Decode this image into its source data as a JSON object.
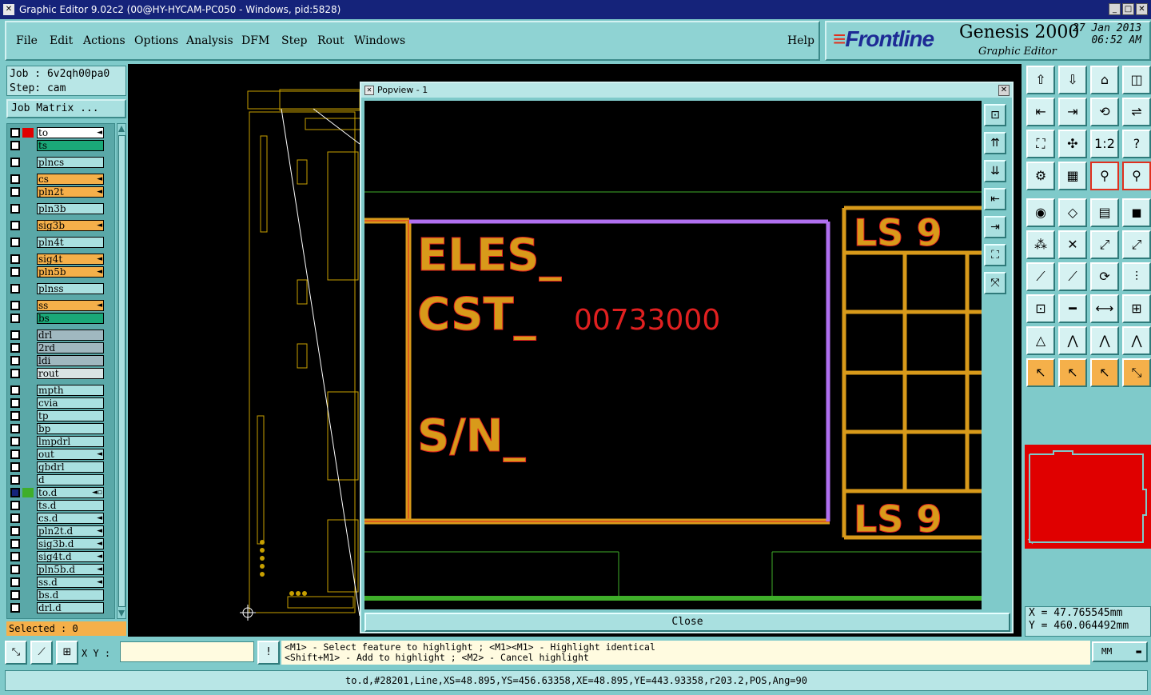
{
  "window": {
    "title": "Graphic Editor 9.02c2 (00@HY-HYCAM-PC050 - Windows, pid:5828)",
    "min": "_",
    "max": "□",
    "close": "✕"
  },
  "menu": [
    "File",
    "Edit",
    "Actions",
    "Options",
    "Analysis",
    "DFM",
    "Step",
    "Rout",
    "Windows"
  ],
  "help": "Help",
  "brand": {
    "logo_stripes": "≡",
    "logo": "Frontline",
    "product": "Genesis 2000",
    "subtitle": "Graphic Editor",
    "date": "27 Jan 2013",
    "time": "06:52 AM"
  },
  "job": {
    "job_line": "Job : 6v2qh00pa0",
    "step_line": "Step: cam",
    "job_matrix": "Job Matrix ..."
  },
  "layers": [
    {
      "name": "to",
      "bg": "#ffffff",
      "color": "#e00000",
      "arrow": "◄"
    },
    {
      "name": "ts",
      "bg": "#1aa878",
      "color": "",
      "arrow": ""
    },
    {
      "name": "plncs",
      "bg": "#a9e0e0",
      "color": "",
      "arrow": ""
    },
    {
      "name": "cs",
      "bg": "#f5b04a",
      "color": "",
      "arrow": "◄"
    },
    {
      "name": "pln2t",
      "bg": "#f5b04a",
      "color": "",
      "arrow": "◄"
    },
    {
      "name": "pln3b",
      "bg": "#a9e0e0",
      "color": "",
      "arrow": ""
    },
    {
      "name": "sig3b",
      "bg": "#f5b04a",
      "color": "",
      "arrow": "◄"
    },
    {
      "name": "pln4t",
      "bg": "#a9e0e0",
      "color": "",
      "arrow": ""
    },
    {
      "name": "sig4t",
      "bg": "#f5b04a",
      "color": "",
      "arrow": "◄"
    },
    {
      "name": "pln5b",
      "bg": "#f5b04a",
      "color": "",
      "arrow": "◄"
    },
    {
      "name": "plnss",
      "bg": "#a9e0e0",
      "color": "",
      "arrow": ""
    },
    {
      "name": "ss",
      "bg": "#f5b04a",
      "color": "",
      "arrow": "◄"
    },
    {
      "name": "bs",
      "bg": "#1aa878",
      "color": "",
      "arrow": ""
    },
    {
      "name": "drl",
      "bg": "#a0b8c0",
      "color": "",
      "arrow": ""
    },
    {
      "name": "2rd",
      "bg": "#a0b8c0",
      "color": "",
      "arrow": ""
    },
    {
      "name": "ldi",
      "bg": "#a0b8c0",
      "color": "",
      "arrow": ""
    },
    {
      "name": "rout",
      "bg": "#d8e4e4",
      "color": "",
      "arrow": ""
    },
    {
      "name": "mpth",
      "bg": "#a9e0e0",
      "color": "",
      "arrow": ""
    },
    {
      "name": "cvia",
      "bg": "#a9e0e0",
      "color": "",
      "arrow": ""
    },
    {
      "name": "tp",
      "bg": "#a9e0e0",
      "color": "",
      "arrow": ""
    },
    {
      "name": "bp",
      "bg": "#a9e0e0",
      "color": "",
      "arrow": ""
    },
    {
      "name": "lmpdrl",
      "bg": "#a9e0e0",
      "color": "",
      "arrow": ""
    },
    {
      "name": "out",
      "bg": "#a9e0e0",
      "color": "",
      "arrow": "◄"
    },
    {
      "name": "gbdrl",
      "bg": "#a9e0e0",
      "color": "",
      "arrow": ""
    },
    {
      "name": "d",
      "bg": "#a9e0e0",
      "color": "",
      "arrow": ""
    },
    {
      "name": "to.d",
      "bg": "#a9e0e0",
      "color": "#3fae2a",
      "arrow": "◄▫"
    },
    {
      "name": "ts.d",
      "bg": "#a9e0e0",
      "color": "",
      "arrow": ""
    },
    {
      "name": "cs.d",
      "bg": "#a9e0e0",
      "color": "",
      "arrow": "◄"
    },
    {
      "name": "pln2t.d",
      "bg": "#a9e0e0",
      "color": "",
      "arrow": "◄"
    },
    {
      "name": "sig3b.d",
      "bg": "#a9e0e0",
      "color": "",
      "arrow": "◄"
    },
    {
      "name": "sig4t.d",
      "bg": "#a9e0e0",
      "color": "",
      "arrow": "◄"
    },
    {
      "name": "pln5b.d",
      "bg": "#a9e0e0",
      "color": "",
      "arrow": "◄"
    },
    {
      "name": "ss.d",
      "bg": "#a9e0e0",
      "color": "",
      "arrow": "◄"
    },
    {
      "name": "bs.d",
      "bg": "#a9e0e0",
      "color": "",
      "arrow": ""
    },
    {
      "name": "drl.d",
      "bg": "#a9e0e0",
      "color": "",
      "arrow": ""
    }
  ],
  "selected": "Selected : 0",
  "popview": {
    "title": "Popview - 1",
    "close_label": "Close",
    "text_eles": "ELES_",
    "text_cst": "CST_",
    "text_sn": "S/N_",
    "text_num": "00733000",
    "text_ls_top": "LS 9",
    "text_ls_bottom": "LS 9"
  },
  "pop_tools": [
    "⊡",
    "⇈",
    "⇊",
    "⇤",
    "⇥",
    "⛶",
    "⤧"
  ],
  "coords": {
    "x": "X = 47.765545mm",
    "y": "Y = 460.064492mm"
  },
  "xy_label": "X Y :",
  "xy_value": "",
  "message": {
    "line1": "<M1> - Select feature to highlight ; <M1><M1> - Highlight identical",
    "line2": "<Shift+M1> - Add to highlight ; <M2> - Cancel highlight"
  },
  "units": "MM",
  "status": "to.d,#28201,Line,XS=48.895,YS=456.63358,XE=48.895,YE=443.93358,r203.2,POS,Ang=90",
  "colors": {
    "orange": "#d89a1a",
    "red": "#e02020",
    "purple": "#b070f0",
    "green": "#3fae2a"
  }
}
